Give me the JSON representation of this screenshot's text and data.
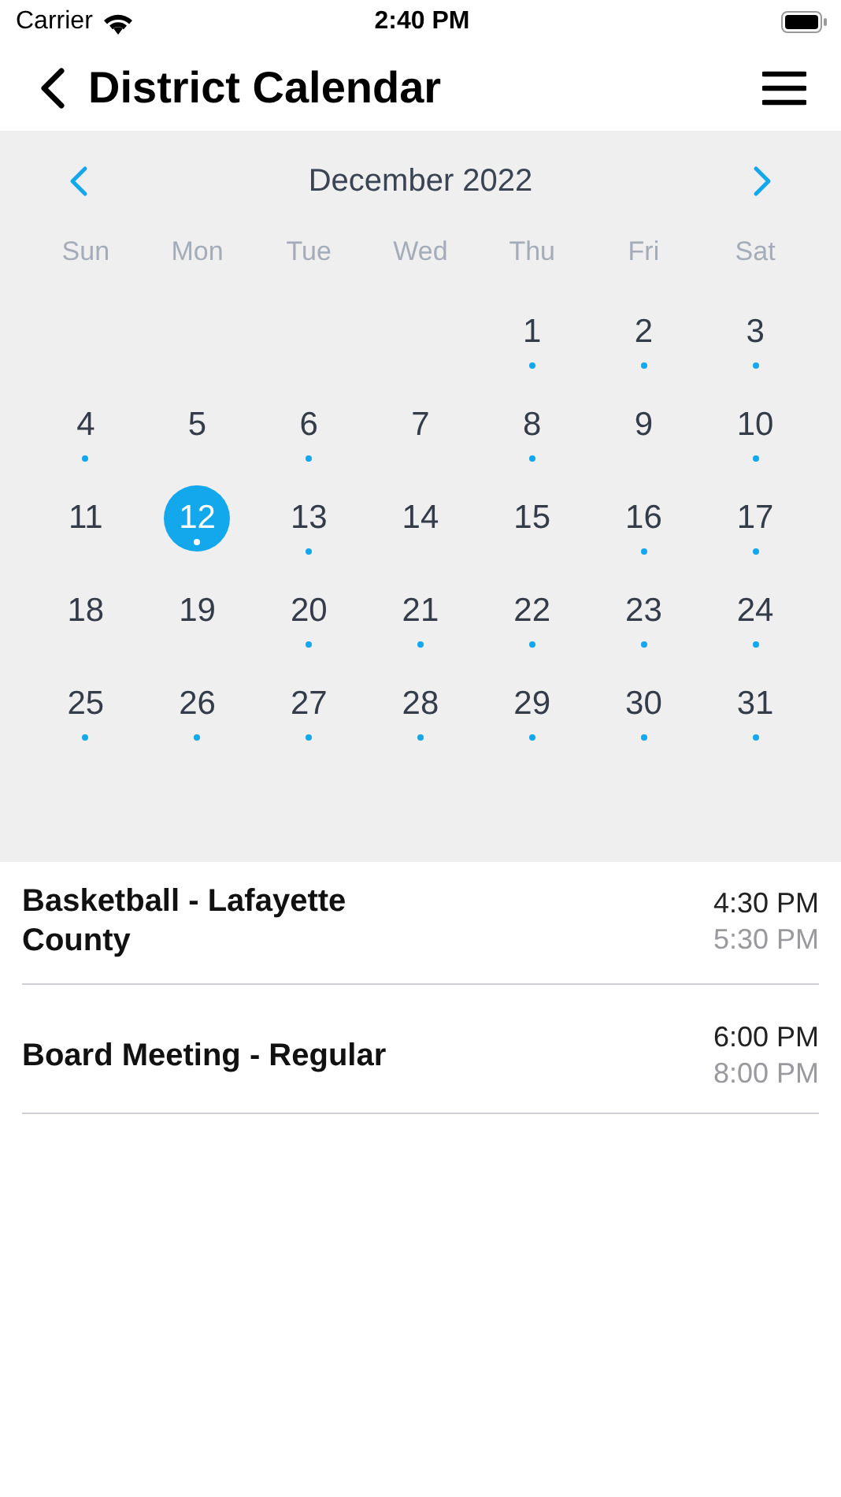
{
  "status_bar": {
    "carrier": "Carrier",
    "time": "2:40 PM"
  },
  "nav": {
    "title": "District Calendar"
  },
  "calendar": {
    "month": "December 2022",
    "weekdays": [
      "Sun",
      "Mon",
      "Tue",
      "Wed",
      "Thu",
      "Fri",
      "Sat"
    ],
    "weeks": [
      {
        "days": [
          {
            "day": "1",
            "has_events": true,
            "selected": false
          },
          {
            "day": "2",
            "has_events": true,
            "selected": false
          },
          {
            "day": "3",
            "has_events": true,
            "selected": false
          }
        ]
      },
      {
        "days": [
          {
            "day": "4",
            "has_events": true,
            "selected": false
          },
          {
            "day": "5",
            "has_events": false,
            "selected": false
          },
          {
            "day": "6",
            "has_events": true,
            "selected": false
          },
          {
            "day": "7",
            "has_events": false,
            "selected": false
          },
          {
            "day": "8",
            "has_events": true,
            "selected": false
          },
          {
            "day": "9",
            "has_events": false,
            "selected": false
          },
          {
            "day": "10",
            "has_events": true,
            "selected": false
          }
        ]
      },
      {
        "days": [
          {
            "day": "11",
            "has_events": false,
            "selected": false
          },
          {
            "day": "12",
            "has_events": true,
            "selected": true
          },
          {
            "day": "13",
            "has_events": true,
            "selected": false
          },
          {
            "day": "14",
            "has_events": false,
            "selected": false
          },
          {
            "day": "15",
            "has_events": false,
            "selected": false
          },
          {
            "day": "16",
            "has_events": true,
            "selected": false
          },
          {
            "day": "17",
            "has_events": true,
            "selected": false
          }
        ]
      },
      {
        "days": [
          {
            "day": "18",
            "has_events": false,
            "selected": false
          },
          {
            "day": "19",
            "has_events": false,
            "selected": false
          },
          {
            "day": "20",
            "has_events": true,
            "selected": false
          },
          {
            "day": "21",
            "has_events": true,
            "selected": false
          },
          {
            "day": "22",
            "has_events": true,
            "selected": false
          },
          {
            "day": "23",
            "has_events": true,
            "selected": false
          },
          {
            "day": "24",
            "has_events": true,
            "selected": false
          }
        ]
      },
      {
        "days": [
          {
            "day": "25",
            "has_events": true,
            "selected": false
          },
          {
            "day": "26",
            "has_events": true,
            "selected": false
          },
          {
            "day": "27",
            "has_events": true,
            "selected": false
          },
          {
            "day": "28",
            "has_events": true,
            "selected": false
          },
          {
            "day": "29",
            "has_events": true,
            "selected": false
          },
          {
            "day": "30",
            "has_events": true,
            "selected": false
          },
          {
            "day": "31",
            "has_events": true,
            "selected": false
          }
        ]
      }
    ]
  },
  "events": [
    {
      "title": "Basketball - Lafayette County",
      "start": "4:30 PM",
      "end": "5:30 PM"
    },
    {
      "title": "Board Meeting - Regular",
      "start": "6:00 PM",
      "end": "8:00 PM"
    }
  ]
}
